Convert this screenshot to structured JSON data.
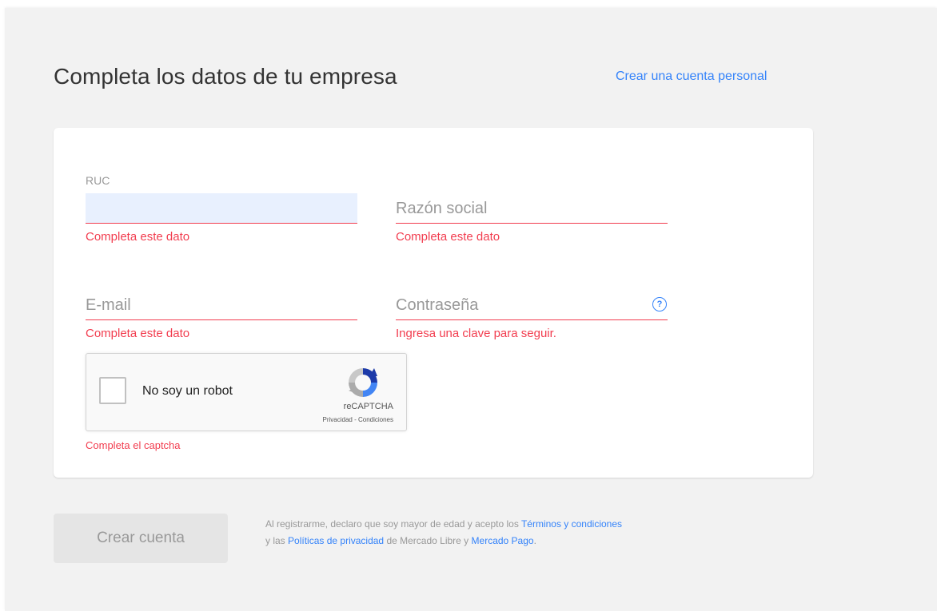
{
  "header": {
    "title": "Completa los datos de tu empresa",
    "personal_account_link": "Crear una cuenta personal"
  },
  "form": {
    "ruc": {
      "label": "RUC",
      "value": "",
      "error": "Completa este dato"
    },
    "razon_social": {
      "placeholder": "Razón social",
      "value": "",
      "error": "Completa este dato"
    },
    "email": {
      "placeholder": "E-mail",
      "value": "",
      "error": "Completa este dato"
    },
    "password": {
      "placeholder": "Contraseña",
      "value": "",
      "error": "Ingresa una clave para seguir.",
      "help_icon": "?"
    }
  },
  "captcha": {
    "label": "No soy un robot",
    "brand": "reCAPTCHA",
    "links": "Privacidad - Condiciones",
    "error": "Completa el captcha",
    "icon": "recaptcha-icon"
  },
  "footer": {
    "submit_label": "Crear cuenta",
    "legal_text_1": "Al registrarme, declaro que soy mayor de edad y acepto los",
    "terms_link": "Términos y condiciones",
    "legal_text_2": "y las",
    "privacy_link": "Políticas de privacidad",
    "legal_text_3": "de Mercado Libre y",
    "mercado_pago_link": "Mercado Pago",
    "legal_text_4": "."
  },
  "colors": {
    "accent": "#3483fa",
    "error": "#f23d4f",
    "background": "#f2f2f2",
    "autofill": "#e8f0fe"
  }
}
